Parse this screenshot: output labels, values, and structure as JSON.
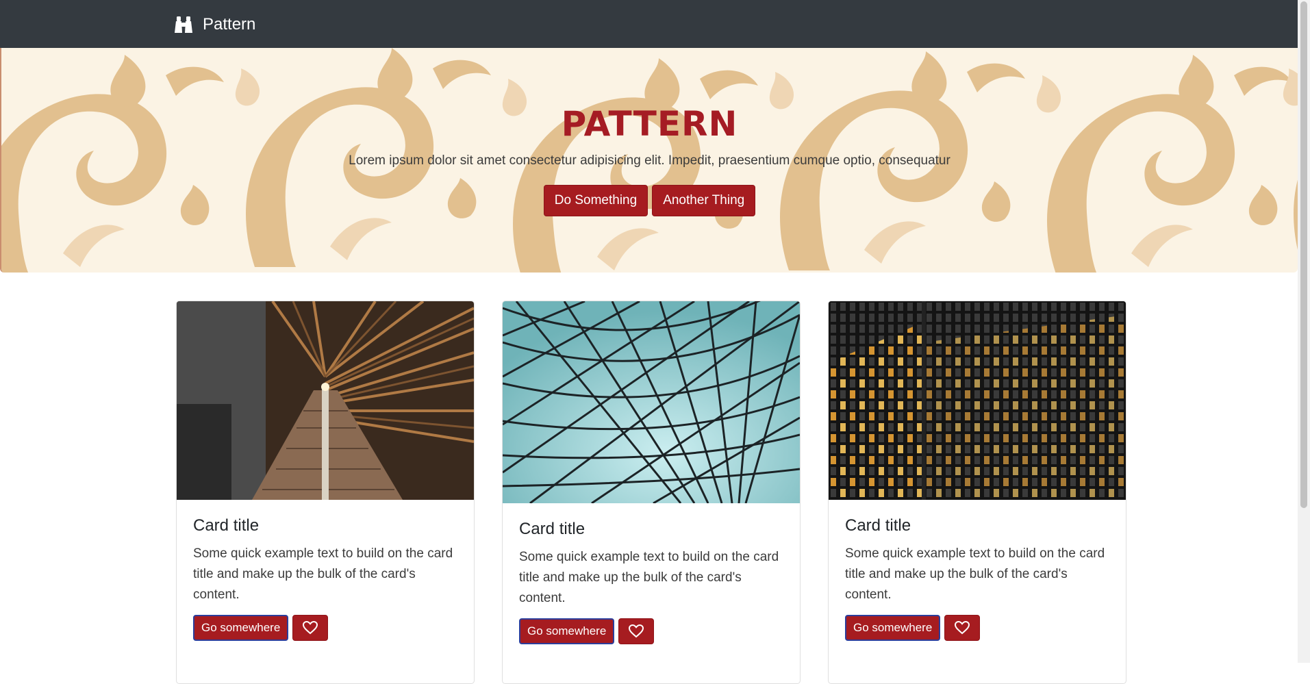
{
  "navbar": {
    "brand": "Pattern",
    "brand_icon": "binoculars-icon"
  },
  "hero": {
    "title": "PATTERN",
    "lead": "Lorem ipsum dolor sit amet consectetur adipisicing elit. Impedit, praesentium cumque optio, consequatur",
    "primary_button": "Do Something",
    "secondary_button": "Another Thing"
  },
  "cards": [
    {
      "title": "Card title",
      "text": "Some quick example text to build on the card title and make up the bulk of the card's content.",
      "button": "Go somewhere",
      "icon": "heart-icon"
    },
    {
      "title": "Card title",
      "text": "Some quick example text to build on the card title and make up the bulk of the card's content.",
      "button": "Go somewhere",
      "icon": "heart-icon"
    },
    {
      "title": "Card title",
      "text": "Some quick example text to build on the card title and make up the bulk of the card's content.",
      "button": "Go somewhere",
      "icon": "heart-icon"
    }
  ],
  "colors": {
    "navbar": "#343a40",
    "accent": "#a61c20",
    "hero_bg": "#fbf3e4",
    "pattern": "#e2c08f"
  }
}
